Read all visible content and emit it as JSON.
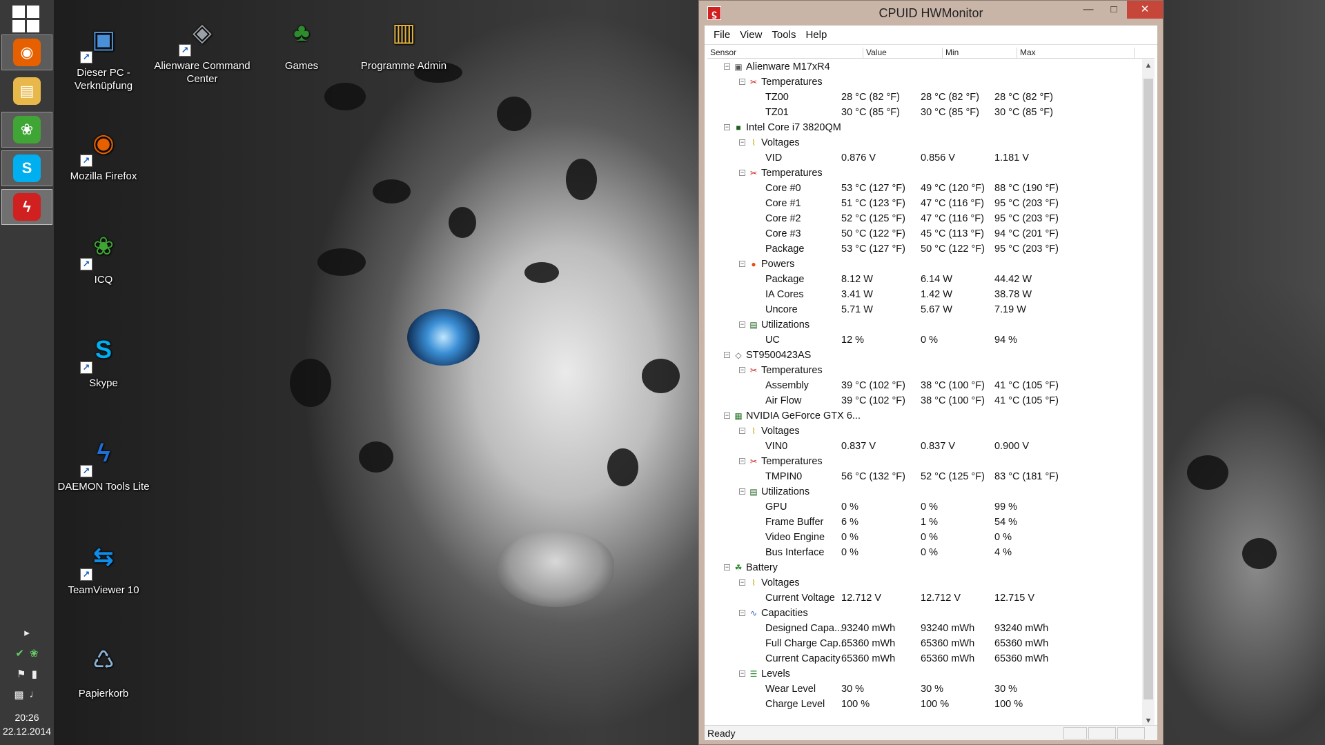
{
  "window": {
    "title": "CPUID HWMonitor",
    "status": "Ready",
    "menu": [
      "File",
      "View",
      "Tools",
      "Help"
    ],
    "columns": [
      "Sensor",
      "Value",
      "Min",
      "Max"
    ],
    "buttons": {
      "minimize": "—",
      "maximize": "□",
      "close": "✕"
    }
  },
  "taskbar": {
    "pinned": [
      {
        "name": "firefox",
        "glyph": "◉",
        "color": "#e66000"
      },
      {
        "name": "file-explorer",
        "glyph": "▤",
        "color": "#e8b84a"
      },
      {
        "name": "icq",
        "glyph": "❀",
        "color": "#3fa535"
      },
      {
        "name": "skype",
        "glyph": "S",
        "color": "#00aff0"
      },
      {
        "name": "hwmonitor",
        "glyph": "ϟ",
        "color": "#d02020"
      }
    ],
    "time": "20:26",
    "date": "22.12.2014"
  },
  "desktop_icons": [
    {
      "label": "Dieser PC - Verknüpfung",
      "icon": "computer-icon",
      "glyph": "▣",
      "color": "#4a90d9"
    },
    {
      "label": "Mozilla Firefox",
      "icon": "firefox-icon",
      "glyph": "◉",
      "color": "#e66000"
    },
    {
      "label": "ICQ",
      "icon": "icq-icon",
      "glyph": "❀",
      "color": "#3fa535"
    },
    {
      "label": "Skype",
      "icon": "skype-icon",
      "glyph": "S",
      "color": "#00aff0"
    },
    {
      "label": "DAEMON Tools Lite",
      "icon": "daemon-tools-icon",
      "glyph": "ϟ",
      "color": "#1d6fd6"
    },
    {
      "label": "TeamViewer 10",
      "icon": "teamviewer-icon",
      "glyph": "⇆",
      "color": "#0e8ee9"
    },
    {
      "label": "Papierkorb",
      "icon": "recycle-bin-icon",
      "glyph": "♺",
      "color": "#8ab4d8"
    },
    {
      "label": "Alienware Command Center",
      "icon": "alienware-icon",
      "glyph": "◈",
      "color": "#9aa0a6"
    },
    {
      "label": "Games",
      "icon": "games-icon",
      "glyph": "♣",
      "color": "#2e8b2e"
    },
    {
      "label": "Programme Admin",
      "icon": "folder-icon",
      "glyph": "▥",
      "color": "#e0b040"
    }
  ],
  "tree": [
    {
      "level": 0,
      "label": "Alienware M17xR4",
      "icon": "computer-icon"
    },
    {
      "level": 1,
      "label": "Temperatures",
      "icon": "thermometer-icon"
    },
    {
      "level": 2,
      "label": "TZ00",
      "value": "28 °C  (82 °F)",
      "min": "28 °C  (82 °F)",
      "max": "28 °C  (82 °F)"
    },
    {
      "level": 2,
      "label": "TZ01",
      "value": "30 °C  (85 °F)",
      "min": "30 °C  (85 °F)",
      "max": "30 °C  (85 °F)"
    },
    {
      "level": 0,
      "label": "Intel Core i7 3820QM",
      "icon": "cpu-icon"
    },
    {
      "level": 1,
      "label": "Voltages",
      "icon": "voltage-icon"
    },
    {
      "level": 2,
      "label": "VID",
      "value": "0.876 V",
      "min": "0.856 V",
      "max": "1.181 V"
    },
    {
      "level": 1,
      "label": "Temperatures",
      "icon": "thermometer-icon"
    },
    {
      "level": 2,
      "label": "Core #0",
      "value": "53 °C  (127 °F)",
      "min": "49 °C  (120 °F)",
      "max": "88 °C  (190 °F)"
    },
    {
      "level": 2,
      "label": "Core #1",
      "value": "51 °C  (123 °F)",
      "min": "47 °C  (116 °F)",
      "max": "95 °C  (203 °F)"
    },
    {
      "level": 2,
      "label": "Core #2",
      "value": "52 °C  (125 °F)",
      "min": "47 °C  (116 °F)",
      "max": "95 °C  (203 °F)"
    },
    {
      "level": 2,
      "label": "Core #3",
      "value": "50 °C  (122 °F)",
      "min": "45 °C  (113 °F)",
      "max": "94 °C  (201 °F)"
    },
    {
      "level": 2,
      "label": "Package",
      "value": "53 °C  (127 °F)",
      "min": "50 °C  (122 °F)",
      "max": "95 °C  (203 °F)"
    },
    {
      "level": 1,
      "label": "Powers",
      "icon": "power-icon"
    },
    {
      "level": 2,
      "label": "Package",
      "value": "8.12 W",
      "min": "6.14 W",
      "max": "44.42 W"
    },
    {
      "level": 2,
      "label": "IA Cores",
      "value": "3.41 W",
      "min": "1.42 W",
      "max": "38.78 W"
    },
    {
      "level": 2,
      "label": "Uncore",
      "value": "5.71 W",
      "min": "5.67 W",
      "max": "7.19 W"
    },
    {
      "level": 1,
      "label": "Utilizations",
      "icon": "utilization-icon"
    },
    {
      "level": 2,
      "label": "UC",
      "value": "12 %",
      "min": "0 %",
      "max": "94 %"
    },
    {
      "level": 0,
      "label": "ST9500423AS",
      "icon": "harddisk-icon"
    },
    {
      "level": 1,
      "label": "Temperatures",
      "icon": "thermometer-icon"
    },
    {
      "level": 2,
      "label": "Assembly",
      "value": "39 °C  (102 °F)",
      "min": "38 °C  (100 °F)",
      "max": "41 °C  (105 °F)"
    },
    {
      "level": 2,
      "label": "Air Flow",
      "value": "39 °C  (102 °F)",
      "min": "38 °C  (100 °F)",
      "max": "41 °C  (105 °F)"
    },
    {
      "level": 0,
      "label": "NVIDIA GeForce GTX 6...",
      "icon": "gpu-icon"
    },
    {
      "level": 1,
      "label": "Voltages",
      "icon": "voltage-icon"
    },
    {
      "level": 2,
      "label": "VIN0",
      "value": "0.837 V",
      "min": "0.837 V",
      "max": "0.900 V"
    },
    {
      "level": 1,
      "label": "Temperatures",
      "icon": "thermometer-icon"
    },
    {
      "level": 2,
      "label": "TMPIN0",
      "value": "56 °C  (132 °F)",
      "min": "52 °C  (125 °F)",
      "max": "83 °C  (181 °F)"
    },
    {
      "level": 1,
      "label": "Utilizations",
      "icon": "utilization-icon"
    },
    {
      "level": 2,
      "label": "GPU",
      "value": "0 %",
      "min": "0 %",
      "max": "99 %"
    },
    {
      "level": 2,
      "label": "Frame Buffer",
      "value": "6 %",
      "min": "1 %",
      "max": "54 %"
    },
    {
      "level": 2,
      "label": "Video Engine",
      "value": "0 %",
      "min": "0 %",
      "max": "0 %"
    },
    {
      "level": 2,
      "label": "Bus Interface",
      "value": "0 %",
      "min": "0 %",
      "max": "4 %"
    },
    {
      "level": 0,
      "label": "Battery",
      "icon": "battery-icon"
    },
    {
      "level": 1,
      "label": "Voltages",
      "icon": "voltage-icon"
    },
    {
      "level": 2,
      "label": "Current Voltage",
      "value": "12.712 V",
      "min": "12.712 V",
      "max": "12.715 V"
    },
    {
      "level": 1,
      "label": "Capacities",
      "icon": "capacity-icon"
    },
    {
      "level": 2,
      "label": "Designed Capa...",
      "value": "93240 mWh",
      "min": "93240 mWh",
      "max": "93240 mWh"
    },
    {
      "level": 2,
      "label": "Full Charge Cap...",
      "value": "65360 mWh",
      "min": "65360 mWh",
      "max": "65360 mWh"
    },
    {
      "level": 2,
      "label": "Current Capacity",
      "value": "65360 mWh",
      "min": "65360 mWh",
      "max": "65360 mWh"
    },
    {
      "level": 1,
      "label": "Levels",
      "icon": "levels-icon"
    },
    {
      "level": 2,
      "label": "Wear Level",
      "value": "30 %",
      "min": "30 %",
      "max": "30 %"
    },
    {
      "level": 2,
      "label": "Charge Level",
      "value": "100 %",
      "min": "100 %",
      "max": "100 %"
    }
  ],
  "tree_icons": {
    "computer-icon": {
      "glyph": "▣",
      "color": "#555"
    },
    "cpu-icon": {
      "glyph": "■",
      "color": "#1f5f1f"
    },
    "harddisk-icon": {
      "glyph": "◇",
      "color": "#555"
    },
    "gpu-icon": {
      "glyph": "▦",
      "color": "#2c7a2c"
    },
    "battery-icon": {
      "glyph": "☘",
      "color": "#2e8b2e"
    },
    "thermometer-icon": {
      "glyph": "✂",
      "color": "#d02020"
    },
    "voltage-icon": {
      "glyph": "⌇",
      "color": "#c8a000"
    },
    "power-icon": {
      "glyph": "●",
      "color": "#e05010"
    },
    "utilization-icon": {
      "glyph": "▤",
      "color": "#1f5f1f"
    },
    "capacity-icon": {
      "glyph": "∿",
      "color": "#3060c0"
    },
    "levels-icon": {
      "glyph": "☰",
      "color": "#2e8b2e"
    }
  }
}
